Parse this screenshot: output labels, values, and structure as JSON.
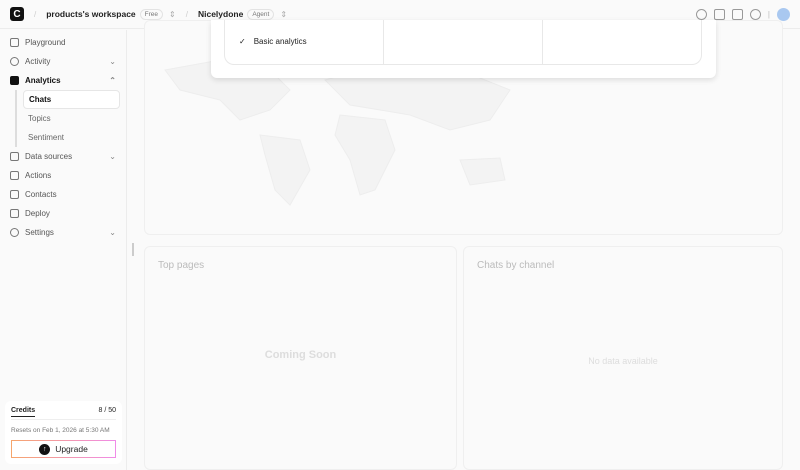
{
  "header": {
    "workspace": "products's workspace",
    "workspace_badge": "Free",
    "agent": "Nicelydone",
    "agent_badge": "Agent"
  },
  "sidebar": {
    "items": [
      {
        "label": "Playground"
      },
      {
        "label": "Activity"
      },
      {
        "label": "Analytics"
      },
      {
        "label": "Data sources"
      },
      {
        "label": "Actions"
      },
      {
        "label": "Contacts"
      },
      {
        "label": "Deploy"
      },
      {
        "label": "Settings"
      }
    ],
    "analytics_sub": [
      {
        "label": "Chats"
      },
      {
        "label": "Topics"
      },
      {
        "label": "Sentiment"
      }
    ]
  },
  "credits": {
    "label": "Credits",
    "value": "8 / 50",
    "reset": "Resets on Feb 1, 2026 at 5:30 AM",
    "upgrade": "Upgrade"
  },
  "modal": {
    "feature": "Basic analytics"
  },
  "cards": {
    "top_pages": "Top pages",
    "top_pages_msg": "Coming Soon",
    "chats_by_channel": "Chats by channel",
    "chats_msg": "No data available"
  }
}
